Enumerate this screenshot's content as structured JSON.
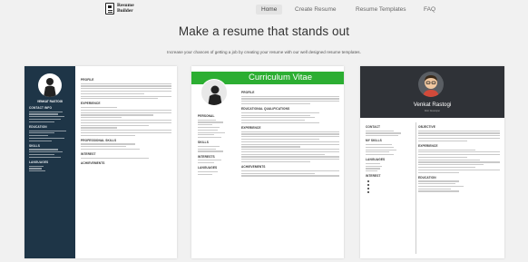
{
  "nav": {
    "logo_line1": "Resume",
    "logo_line2": "Builder",
    "links": [
      "Home",
      "Create Resume",
      "Resume Templates",
      "FAQ"
    ]
  },
  "hero": {
    "title": "Make a resume that stands out",
    "subtitle": "Increase your chances of getting a job by creating your resume with our well designed resume templates."
  },
  "templates": [
    {
      "name": "VENKAT RASTOGI",
      "sections_side": [
        "CONTACT INFO",
        "EDUCATION",
        "SKILLS",
        "LANGUAGES"
      ],
      "sections_main": [
        "PROFILE",
        "EXPERIENCE",
        "PROFESSIONAL SKILLS",
        "INTEREST",
        "ACHIEVEMENTS"
      ],
      "colors": {
        "sidebar": "#1e3547"
      }
    },
    {
      "banner": "Curriculum Vitae",
      "sections_left": [
        "PERSONAL",
        "SKILLS",
        "INTERESTS",
        "LANGUAGES"
      ],
      "sections_right": [
        "PROFILE",
        "EDUCATIONAL QUALIFICATIONS",
        "EXPERIENCE",
        "ACHIEVEMENTS"
      ],
      "colors": {
        "banner": "#2cae32"
      }
    },
    {
      "name": "Venkat Rastogi",
      "role": "Web Developer",
      "sections_left": [
        "CONTACT",
        "MY SKILLS",
        "LANGUAGES",
        "INTEREST"
      ],
      "sections_right": [
        "OBJECTIVE",
        "EXPERIENCE",
        "EDUCATION"
      ],
      "colors": {
        "header": "#2f3237"
      }
    }
  ]
}
